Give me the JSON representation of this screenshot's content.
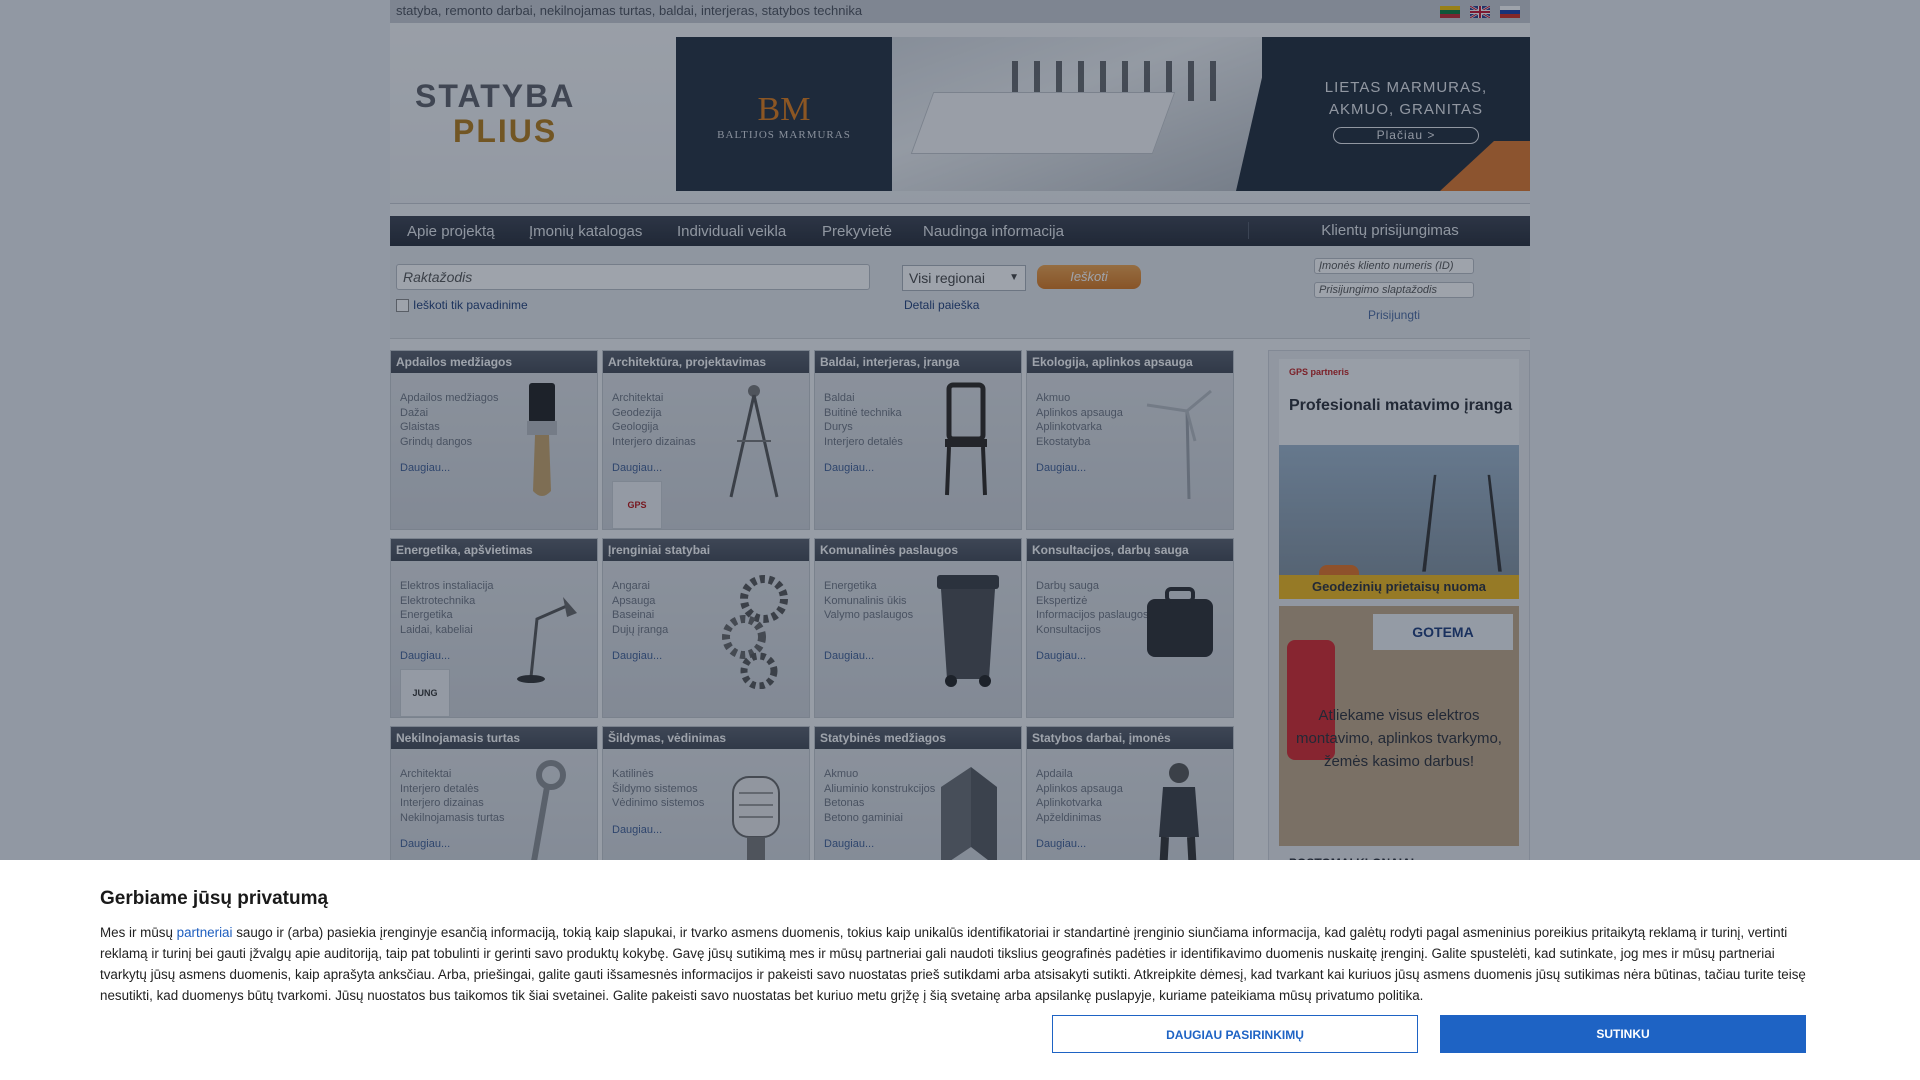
{
  "site": {
    "tagline": "statyba, remonto darbai, nekilnojamas turtas, baldai, interjeras, statybos technika",
    "logo_line1": "STATYBA",
    "logo_line2": "PLIUS"
  },
  "banner": {
    "brand_mark": "BM",
    "brand_name": "BALTIJOS MARMURAS",
    "headline": "LIETAS MARMURAS, AKMUO, GRANITAS",
    "cta": "Plačiau >"
  },
  "nav": {
    "items": [
      "Apie projektą",
      "Įmonių katalogas",
      "Individuali veikla",
      "Prekyvietė",
      "Naudinga informacija"
    ],
    "login_title": "Klientų prisijungimas"
  },
  "search": {
    "keyword_placeholder": "Raktažodis",
    "name_only_label": "Ieškoti tik pavadinime",
    "region_selected": "Visi regionai",
    "search_button": "Ieškoti",
    "detail_link": "Detali paieška"
  },
  "login": {
    "id_placeholder": "Įmonės kliento numeris (ID)",
    "password_placeholder": "Prisijungimo slaptažodis",
    "submit": "Prisijungti"
  },
  "categories": [
    {
      "title": "Apdailos medžiagos",
      "items": [
        "Apdailos medžiagos",
        "Dažai",
        "Glaistas",
        "Grindų dangos"
      ],
      "more": "Daugiau..."
    },
    {
      "title": "Architektūra, projektavimas",
      "items": [
        "Architektai",
        "Geodezija",
        "Geologija",
        "Interjero dizainas"
      ],
      "more": "Daugiau...",
      "logo": "GPS"
    },
    {
      "title": "Baldai, interjeras, įranga",
      "items": [
        "Baldai",
        "Buitinė technika",
        "Durys",
        "Interjero detalės"
      ],
      "more": "Daugiau..."
    },
    {
      "title": "Ekologija, aplinkos apsauga",
      "items": [
        "Akmuo",
        "Aplinkos apsauga",
        "Aplinkotvarka",
        "Ekostatyba"
      ],
      "more": "Daugiau..."
    },
    {
      "title": "Energetika, apšvietimas",
      "items": [
        "Elektros instaliacija",
        "Elektrotechnika",
        "Energetika",
        "Laidai, kabeliai"
      ],
      "more": "Daugiau...",
      "logo": "JUNG"
    },
    {
      "title": "Įrenginiai statybai",
      "items": [
        "Angarai",
        "Apsauga",
        "Baseinai",
        "Dujų įranga"
      ],
      "more": "Daugiau..."
    },
    {
      "title": "Komunalinės paslaugos",
      "items": [
        "Energetika",
        "Komunalinis ūkis",
        "Valymo paslaugos"
      ],
      "more": "Daugiau..."
    },
    {
      "title": "Konsultacijos, darbų sauga",
      "items": [
        "Darbų sauga",
        "Ekspertizė",
        "Informacijos paslaugos",
        "Konsultacijos"
      ],
      "more": "Daugiau..."
    },
    {
      "title": "Nekilnojamasis turtas",
      "items": [
        "Architektai",
        "Interjero detalės",
        "Interjero dizainas",
        "Nekilnojamasis turtas"
      ],
      "more": "Daugiau..."
    },
    {
      "title": "Šildymas, vėdinimas",
      "items": [
        "Katilinės",
        "Šildymo sistemos",
        "Vėdinimo sistemos"
      ],
      "more": "Daugiau..."
    },
    {
      "title": "Statybinės medžiagos",
      "items": [
        "Akmuo",
        "Aliuminio konstrukcijos",
        "Betonas",
        "Betono gaminiai"
      ],
      "more": "Daugiau..."
    },
    {
      "title": "Statybos darbai, įmonės",
      "items": [
        "Apdaila",
        "Aplinkos apsauga",
        "Aplinkotvarka",
        "Apželdinimas"
      ],
      "more": "Daugiau..."
    }
  ],
  "sidebar": {
    "ad1_partner": "GPS partneris",
    "ad1_title": "Profesionali matavimo įranga",
    "ad1_bar": "Geodezinių prietaisų nuoma",
    "ad2_brand": "GOTEMA",
    "ad2_text": "Atliekame visus elektros montavimo, aplinkos tvarkymo, žemės kasimo darbus!",
    "ad3_text": "POSTOMAI KLONAIAI"
  },
  "consent": {
    "title": "Gerbiame jūsų privatumą",
    "text_before_link": "Mes ir mūsų ",
    "link": "partneriai",
    "text_after_link": " saugo ir (arba) pasiekia įrenginyje esančią informaciją, tokią kaip slapukai, ir tvarko asmens duomenis, tokius kaip unikalūs identifikatoriai ir standartinė įrenginio siunčiama informacija, kad galėtų rodyti pagal asmeninius poreikius pritaikytą reklamą ir turinį, vertinti reklamą ir turinį bei gauti įžvalgų apie auditoriją, taip pat tobulinti ir gerinti savo produktų kokybę. Gavę jūsų sutikimą mes ir mūsų partneriai gali naudoti tikslius geografinės padėties ir identifikavimo duomenis nuskaitę įrenginį. Galite spustelėti, kad sutinkate, jog mes ir mūsų partneriai tvarkytų jūsų asmens duomenis, kaip aprašyta anksčiau. Arba, priešingai, galite gauti išsamesnės informacijos ir pakeisti savo nuostatas prieš sutikdami arba atsisakyti sutikti. Atkreipkite dėmesį, kad tvarkant kai kuriuos jūsų asmens duomenis jūsų sutikimas nėra būtinas, tačiau turite teisę nesutikti, kad duomenys būtų tvarkomi. Jūsų nuostatos bus taikomos tik šiai svetainei. Galite pakeisti savo nuostatas bet kuriuo metu grįžę į šią svetainę arba apsilankę puslapyje, kuriame pateikiama mūsų privatumo politika.",
    "more_button": "DAUGIAU PASIRINKIMŲ",
    "accept_button": "SUTINKU"
  },
  "colors": {
    "nav_bg": "#2f3542",
    "category_header": "#4c525e",
    "accent_orange": "#e08a2e",
    "consent_blue": "#1e63c4"
  }
}
